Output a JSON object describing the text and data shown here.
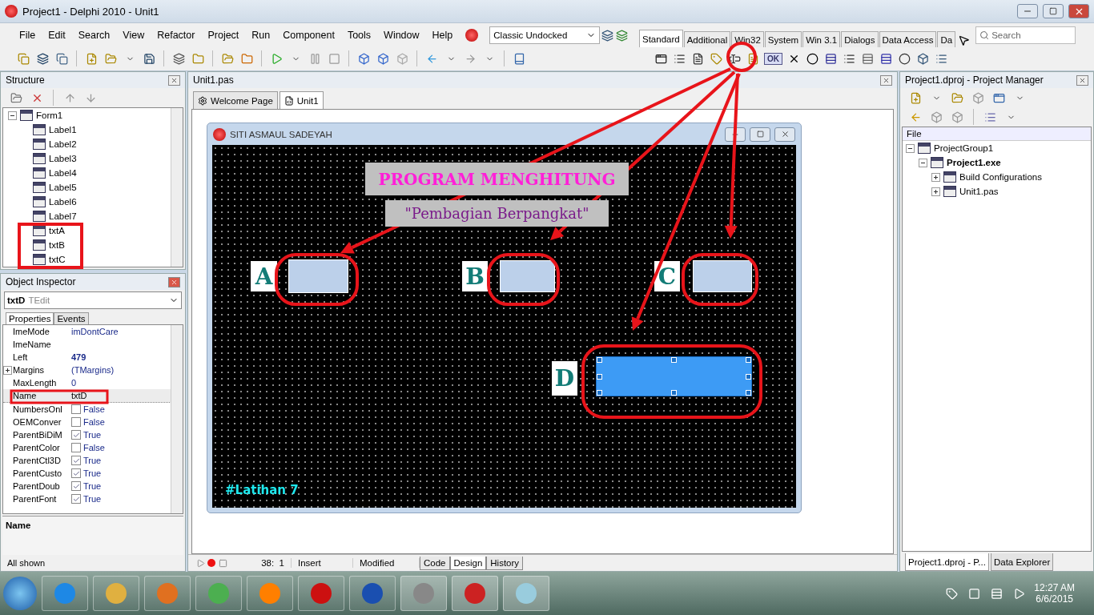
{
  "window": {
    "title": "Project1 - Delphi 2010 - Unit1"
  },
  "menu": [
    "File",
    "Edit",
    "Search",
    "View",
    "Refactor",
    "Project",
    "Run",
    "Component",
    "Tools",
    "Window",
    "Help"
  ],
  "layout_combo": {
    "value": "Classic Undocked"
  },
  "palette": {
    "tabs": [
      {
        "label": "Standard",
        "selected": true
      },
      {
        "label": "Additional",
        "selected": false
      },
      {
        "label": "Win32",
        "selected": false
      },
      {
        "label": "System",
        "selected": false
      },
      {
        "label": "Win 3.1",
        "selected": false
      },
      {
        "label": "Dialogs",
        "selected": false
      },
      {
        "label": "Data Access",
        "selected": false
      },
      {
        "label": "Da",
        "selected": false
      }
    ],
    "search_placeholder": "Search",
    "ok_glyph": "OK"
  },
  "structure": {
    "title": "Structure",
    "tree": [
      {
        "label": "Form1",
        "expanded": true,
        "children": [
          {
            "label": "Label1"
          },
          {
            "label": "Label2"
          },
          {
            "label": "Label3"
          },
          {
            "label": "Label4"
          },
          {
            "label": "Label5"
          },
          {
            "label": "Label6"
          },
          {
            "label": "Label7"
          },
          {
            "label": "txtA"
          },
          {
            "label": "txtB"
          },
          {
            "label": "txtC"
          }
        ]
      }
    ]
  },
  "inspector": {
    "title": "Object Inspector",
    "object_name": "txtD",
    "object_type": "TEdit",
    "tabs": [
      {
        "label": "Properties",
        "selected": true
      },
      {
        "label": "Events",
        "selected": false
      }
    ],
    "properties": [
      {
        "name": "ImeMode",
        "value": "imDontCare",
        "kind": "text",
        "selected": false
      },
      {
        "name": "ImeName",
        "kind": "text",
        "selected": false
      },
      {
        "name": "Left",
        "value": "479",
        "kind": "number",
        "selected": false
      },
      {
        "name": "Margins",
        "value": "(TMargins)",
        "kind": "text",
        "expandable": true,
        "selected": false
      },
      {
        "name": "MaxLength",
        "value": "0",
        "kind": "text",
        "selected": false
      },
      {
        "name": "Name",
        "value": "txtD",
        "kind": "text",
        "selected": true
      },
      {
        "name": "NumbersOnl",
        "value": "False",
        "kind": "check",
        "checked": false,
        "selected": false
      },
      {
        "name": "OEMConver",
        "value": "False",
        "kind": "check",
        "checked": false,
        "selected": false
      },
      {
        "name": "ParentBiDiM",
        "value": "True",
        "kind": "check",
        "checked": true,
        "selected": false
      },
      {
        "name": "ParentColor",
        "value": "False",
        "kind": "check",
        "checked": false,
        "selected": false
      },
      {
        "name": "ParentCtl3D",
        "value": "True",
        "kind": "check",
        "checked": true,
        "selected": false
      },
      {
        "name": "ParentCusto",
        "value": "True",
        "kind": "check",
        "checked": true,
        "selected": false
      },
      {
        "name": "ParentDoub",
        "value": "True",
        "kind": "check",
        "checked": true,
        "selected": false
      },
      {
        "name": "ParentFont",
        "value": "True",
        "kind": "check",
        "checked": true,
        "selected": false
      }
    ],
    "description_title": "Name",
    "status": "All shown"
  },
  "editor": {
    "title": "Unit1.pas",
    "tabs": [
      {
        "label": "Welcome Page",
        "selected": false
      },
      {
        "label": "Unit1",
        "selected": true
      }
    ],
    "form": {
      "caption": "SITI ASMAUL SADEYAH",
      "heading": "PROGRAM MENGHITUNG",
      "subtitle": "\"Pembagian Berpangkat\"",
      "footer": "#Latihan 7",
      "fields": [
        {
          "label": "A",
          "selected": false
        },
        {
          "label": "B",
          "selected": false
        },
        {
          "label": "C",
          "selected": false
        },
        {
          "label": "D",
          "selected": true
        }
      ]
    },
    "status": {
      "position": "38:  1",
      "mode": "Insert",
      "modified": "Modified"
    },
    "view_tabs": [
      {
        "label": "Code",
        "selected": false
      },
      {
        "label": "Design",
        "selected": true
      },
      {
        "label": "History",
        "selected": false
      }
    ]
  },
  "project_manager": {
    "title": "Project1.dproj - Project Manager",
    "column": "File",
    "tree": [
      {
        "label": "ProjectGroup1",
        "active": false,
        "expanded": true,
        "children": [
          {
            "label": "Project1.exe",
            "active": true,
            "expanded": true,
            "children": [
              {
                "label": "Build Configurations",
                "active": false,
                "expanded": false
              },
              {
                "label": "Unit1.pas",
                "active": false,
                "expanded": false
              }
            ]
          }
        ]
      }
    ],
    "tabs": [
      {
        "label": "Project1.dproj - P...",
        "selected": true
      },
      {
        "label": "Data Explorer",
        "selected": false
      }
    ]
  },
  "taskbar": {
    "time": "12:27 AM",
    "date": "6/6/2015"
  }
}
